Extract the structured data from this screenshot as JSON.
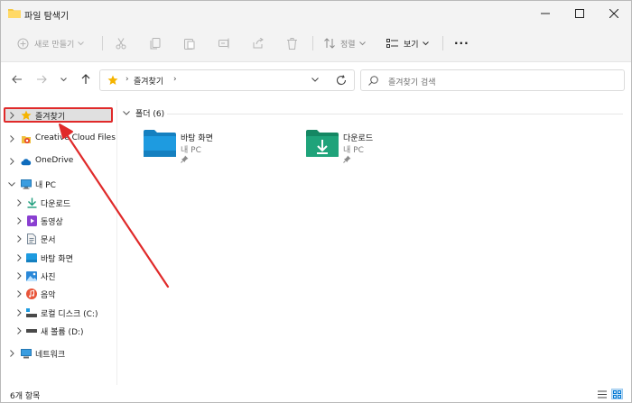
{
  "window": {
    "title": "파일 탐색기"
  },
  "commandbar": {
    "new_label": "새로 만들기",
    "sort_label": "정렬",
    "view_label": "보기",
    "more_label": "···"
  },
  "address": {
    "path_label": "즐겨찾기",
    "search_placeholder": "즐겨찾기 검색"
  },
  "navpane": {
    "items": [
      {
        "label": "즐겨찾기",
        "icon": "star-icon"
      },
      {
        "label": "Creative Cloud Files",
        "icon": "creative-cloud-icon"
      },
      {
        "label": "OneDrive",
        "icon": "onedrive-cloud-icon"
      },
      {
        "label": "내 PC",
        "icon": "pc-icon"
      },
      {
        "label": "다운로드",
        "icon": "download-icon"
      },
      {
        "label": "동영상",
        "icon": "video-icon"
      },
      {
        "label": "문서",
        "icon": "document-icon"
      },
      {
        "label": "바탕 화면",
        "icon": "desktop-icon"
      },
      {
        "label": "사진",
        "icon": "pictures-icon"
      },
      {
        "label": "음악",
        "icon": "music-icon"
      },
      {
        "label": "로컬 디스크 (C:)",
        "icon": "drive-c-icon"
      },
      {
        "label": "새 볼륨 (D:)",
        "icon": "drive-d-icon"
      },
      {
        "label": "네트워크",
        "icon": "network-icon"
      }
    ]
  },
  "content": {
    "group_label": "폴더 (6)",
    "tiles": [
      {
        "name": "바탕 화면",
        "location": "내 PC",
        "icon": "desktop-folder-icon"
      },
      {
        "name": "다운로드",
        "location": "내 PC",
        "icon": "downloads-folder-icon"
      }
    ]
  },
  "status": {
    "count_label": "6개 항목"
  },
  "colors": {
    "accent": "#0078d4",
    "highlight": "#e02a2a",
    "folder_blue": "#1e9be0",
    "folder_green": "#1fa37a",
    "star": "#f5b400"
  }
}
